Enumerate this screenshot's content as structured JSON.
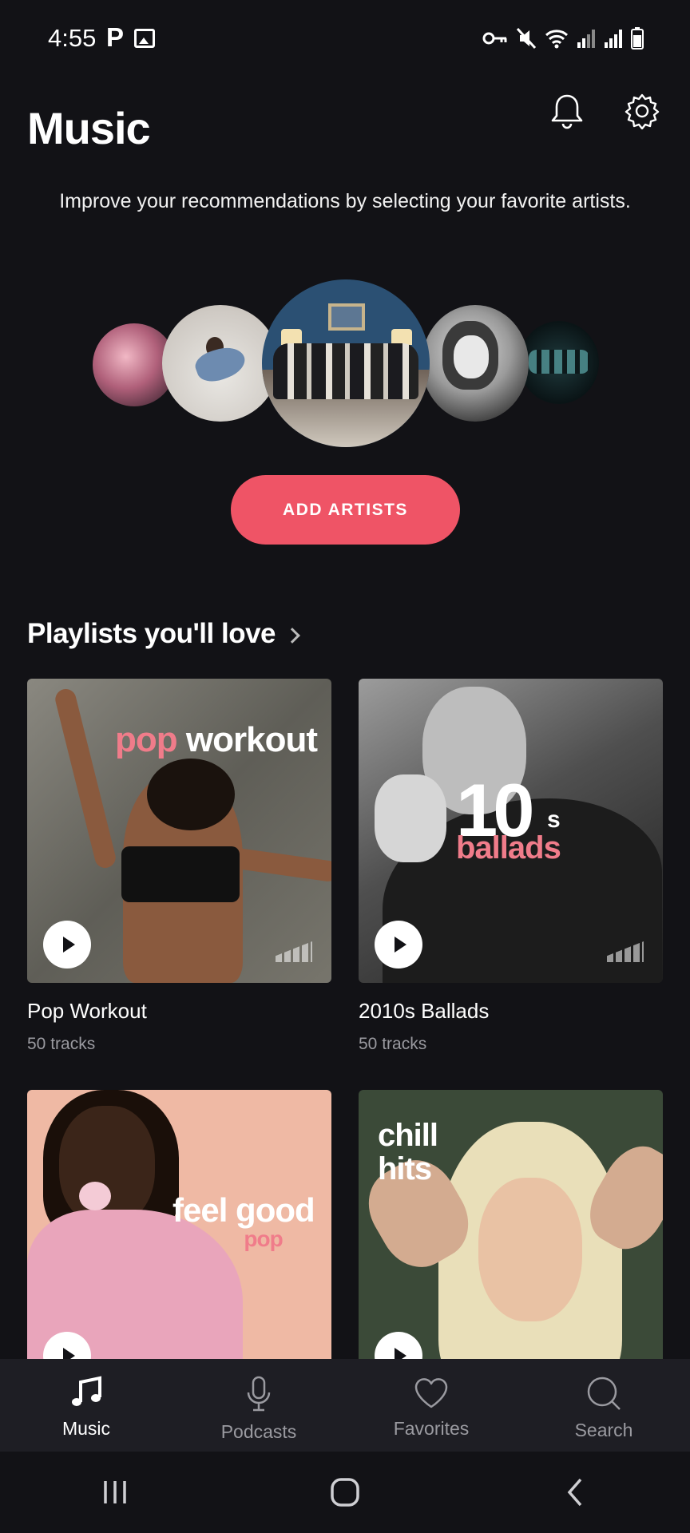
{
  "status_bar": {
    "time": "4:55",
    "carrier_letter": "P"
  },
  "header": {
    "title": "Music"
  },
  "intro": {
    "text": "Improve your recommendations by selecting your favorite artists."
  },
  "add_artists": {
    "label": "ADD ARTISTS"
  },
  "playlists": {
    "section_title": "Playlists you'll love",
    "items": [
      {
        "cover_text_accent": "pop",
        "cover_text_main": "workout",
        "title": "Pop Workout",
        "subtitle": "50 tracks"
      },
      {
        "cover_text_number": "10",
        "cover_text_suffix": "s",
        "cover_text_accent": "ballads",
        "title": "2010s Ballads",
        "subtitle": "50 tracks"
      },
      {
        "cover_text_main": "feel good",
        "cover_text_accent": "pop",
        "title": "",
        "subtitle": ""
      },
      {
        "cover_text_line1": "chill",
        "cover_text_line2": "hits",
        "title": "",
        "subtitle": ""
      }
    ]
  },
  "bottom_nav": {
    "items": [
      {
        "label": "Music",
        "icon": "music-note-icon",
        "active": true
      },
      {
        "label": "Podcasts",
        "icon": "microphone-icon",
        "active": false
      },
      {
        "label": "Favorites",
        "icon": "heart-icon",
        "active": false
      },
      {
        "label": "Search",
        "icon": "search-icon",
        "active": false
      }
    ]
  },
  "colors": {
    "background": "#121216",
    "accent": "#ef5466",
    "cover_pink": "#f07c8a",
    "nav_background": "#1e1e24"
  }
}
